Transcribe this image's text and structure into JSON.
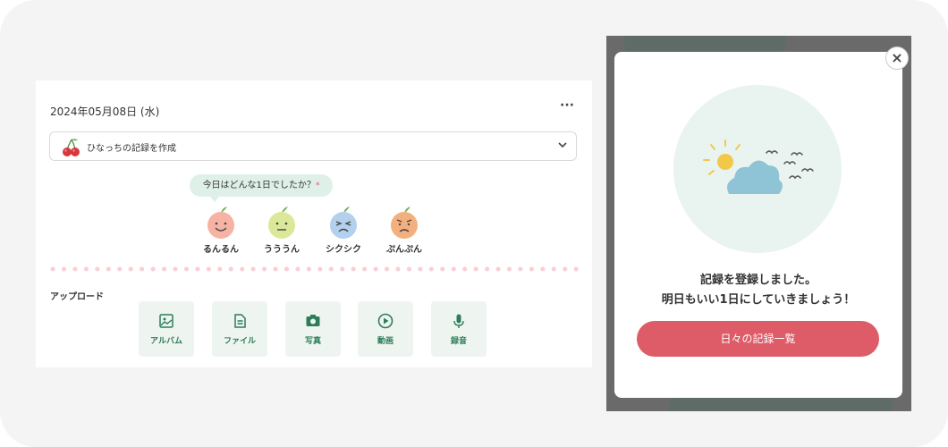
{
  "entry": {
    "date": "2024年05月08日 (水)",
    "more_label": "···",
    "template_select": {
      "value": "ひなっちの記録を作成"
    },
    "prompt": {
      "text": "今日はどんな1日でしたか？",
      "required_mark": "*"
    },
    "moods": [
      {
        "label": "るんるん",
        "icon": "happy-face-icon",
        "color": "#f6b3a4"
      },
      {
        "label": "うううん",
        "icon": "neutral-face-icon",
        "color": "#dbe89a"
      },
      {
        "label": "シクシク",
        "icon": "crying-face-icon",
        "color": "#b3d0ec"
      },
      {
        "label": "ぷんぷん",
        "icon": "angry-face-icon",
        "color": "#f3b07e"
      }
    ],
    "upload": {
      "title": "アップロード",
      "buttons": [
        {
          "label": "アルバム",
          "icon": "image-icon"
        },
        {
          "label": "ファイル",
          "icon": "file-icon"
        },
        {
          "label": "写真",
          "icon": "camera-icon"
        },
        {
          "label": "動画",
          "icon": "play-icon"
        },
        {
          "label": "録音",
          "icon": "microphone-icon"
        }
      ]
    }
  },
  "modal": {
    "close_label": "×",
    "message_line1": "記録を登録しました。",
    "message_line2": "明日もいい1日にしていきましょう！",
    "cta_label": "日々の記録一覧"
  },
  "colors": {
    "accent_green": "#2e7d5a",
    "cta_red": "#de5b68",
    "bubble_bg": "#def0e8"
  }
}
